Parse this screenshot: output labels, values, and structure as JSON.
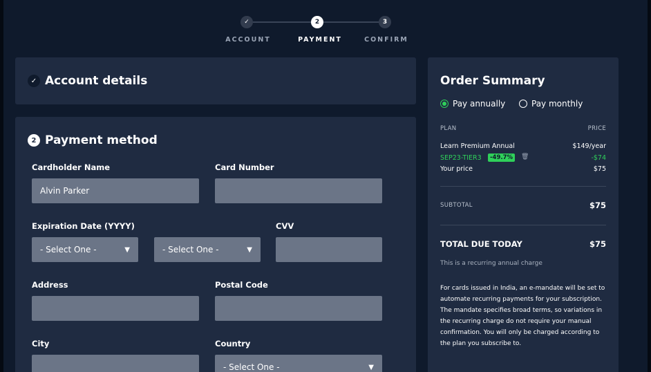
{
  "stepper": {
    "steps": [
      {
        "marker": "✓",
        "label": "ACCOUNT",
        "state": "complete"
      },
      {
        "marker": "2",
        "label": "PAYMENT",
        "state": "active"
      },
      {
        "marker": "3",
        "label": "CONFIRM",
        "state": "pending"
      }
    ]
  },
  "account_section": {
    "badge": "✓",
    "title": "Account details"
  },
  "payment_section": {
    "badge": "2",
    "title": "Payment method",
    "cardholder": {
      "label": "Cardholder Name",
      "value": "Alvin Parker"
    },
    "card_number": {
      "label": "Card Number",
      "value": ""
    },
    "expiration": {
      "label": "Expiration Date (YYYY)",
      "month_value": "- Select One -",
      "year_value": "- Select One -"
    },
    "cvv": {
      "label": "CVV",
      "value": ""
    },
    "address": {
      "label": "Address",
      "value": ""
    },
    "postal_code": {
      "label": "Postal Code",
      "value": ""
    },
    "city": {
      "label": "City",
      "value": ""
    },
    "country": {
      "label": "Country",
      "value": "- Select One -"
    }
  },
  "order_summary": {
    "title": "Order Summary",
    "billing_options": [
      {
        "label": "Pay annually",
        "selected": true
      },
      {
        "label": "Pay monthly",
        "selected": false
      }
    ],
    "columns": {
      "plan": "PLAN",
      "price": "PRICE"
    },
    "plan_name": "Learn Premium Annual",
    "plan_price": "$149/year",
    "coupon_code": "SEP23-TIER3",
    "coupon_discount_badge": "-49.7%",
    "coupon_amount": "-$74",
    "your_price_label": "Your price",
    "your_price": "$75",
    "subtotal_label": "SUBTOTAL",
    "subtotal": "$75",
    "total_label": "TOTAL DUE TODAY",
    "total": "$75",
    "recurring_note": "This is a recurring annual charge",
    "mandate_text": "For cards issued in India, an e-mandate will be set to automate recurring payments for your subscription. The mandate specifies broad terms, so variations in the recurring charge do not require your manual confirmation. You will only be charged according to the plan you subscribe to."
  },
  "colors": {
    "background": "#0f1a2c",
    "panel": "#1f2b41",
    "input": "#6b7587",
    "accent_green": "#2fd05a"
  }
}
